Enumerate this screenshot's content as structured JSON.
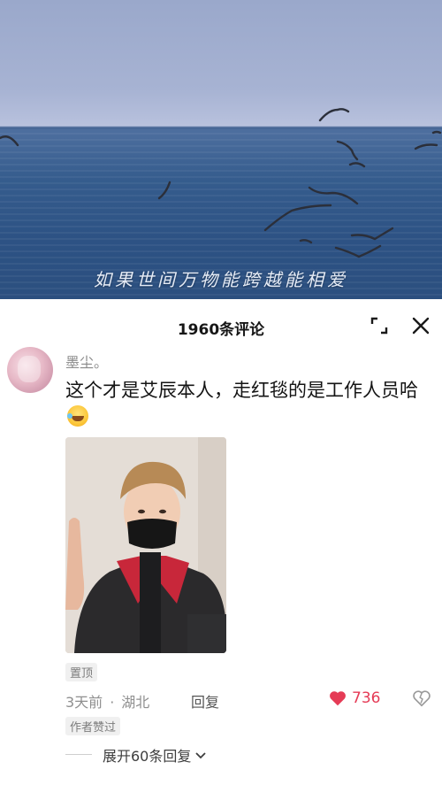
{
  "video": {
    "subtitle": "如果世间万物能跨越能相爱"
  },
  "comments_panel": {
    "count_label": "1960条评论",
    "expand_icon": "expand-icon",
    "close_icon": "close-icon"
  },
  "comment": {
    "username": "墨尘。",
    "text": "这个才是艾辰本人，走红毯的是工作人员哈",
    "emoji": "laughing-tears-emoji",
    "pinned_label": "置顶",
    "time": "3天前",
    "location": "湖北",
    "separator": "·",
    "reply_label": "回复",
    "like_count": "736",
    "liked": true,
    "author_liked_label": "作者赞过",
    "expand_replies_label": "展开60条回复"
  },
  "colors": {
    "like_red": "#e53b56",
    "text_primary": "#141414",
    "text_secondary": "#8f8f8f"
  }
}
